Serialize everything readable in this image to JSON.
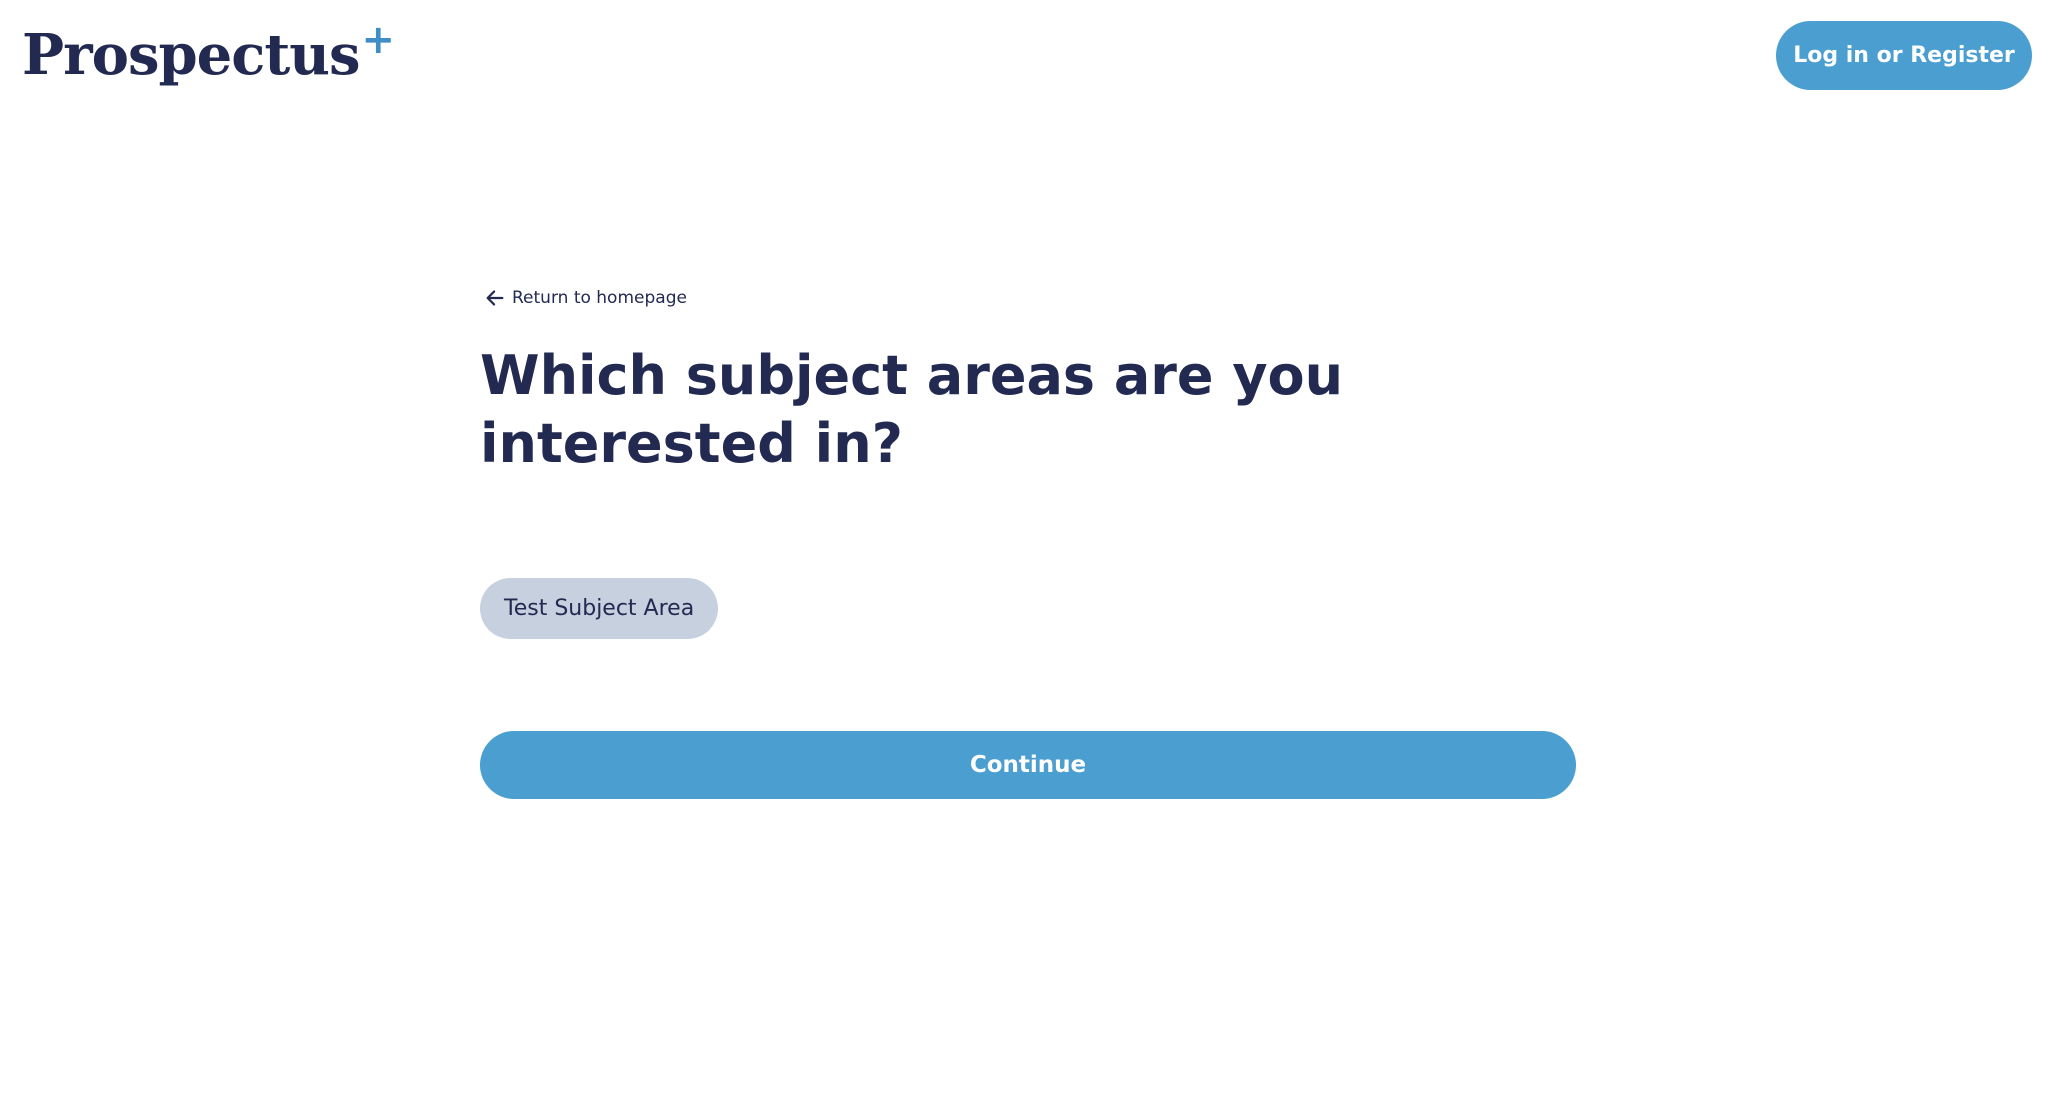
{
  "header": {
    "logo_text": "Prospectus",
    "logo_mark": "+",
    "login_label": "Log in or Register"
  },
  "main": {
    "back_link_label": "Return to homepage",
    "back_icon": "arrow-left-icon",
    "title": "Which subject areas are you interested in?",
    "subject_areas": [
      {
        "label": "Test Subject Area"
      }
    ],
    "continue_label": "Continue"
  },
  "colors": {
    "navy": "#232a52",
    "accent_blue": "#4a9ed0",
    "logo_plus": "#3f8fc6",
    "chip_background": "#c7d0de"
  }
}
